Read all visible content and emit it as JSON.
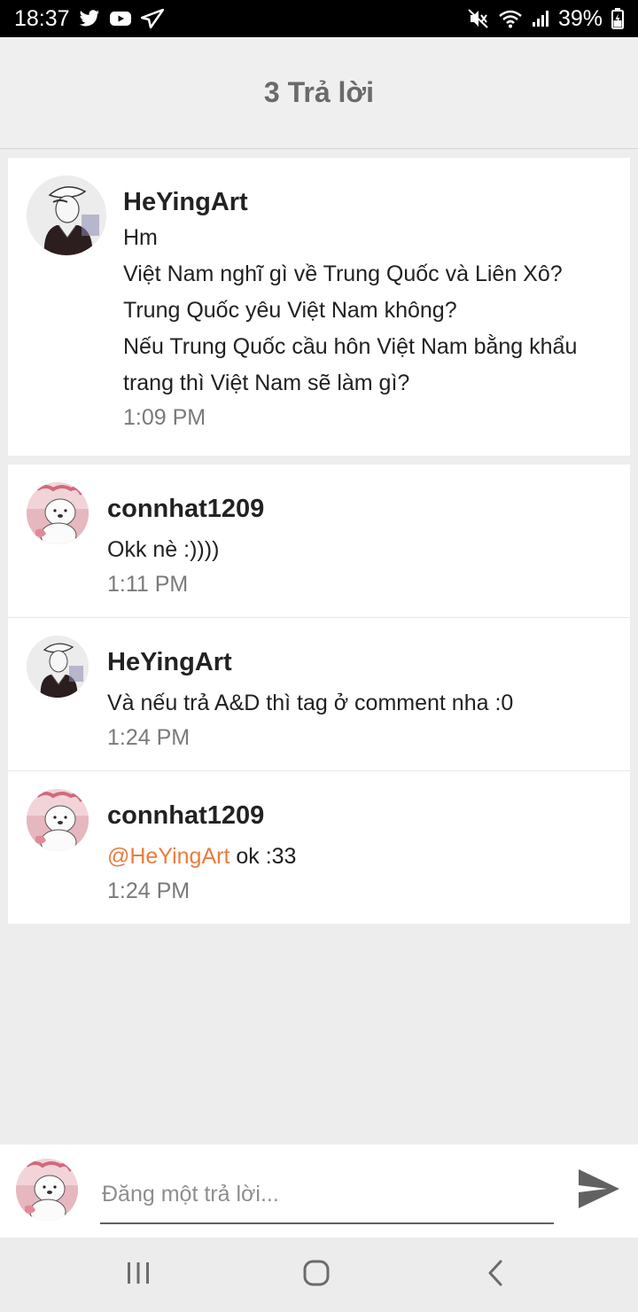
{
  "status_bar": {
    "time": "18:37",
    "battery": "39%",
    "icons": [
      "twitter-icon",
      "youtube-icon",
      "send-arrow-icon",
      "mute-icon",
      "wifi-icon",
      "signal-icon",
      "battery-icon"
    ]
  },
  "header": {
    "title": "3 Trả lời"
  },
  "post": {
    "author": "HeYingArt",
    "lines": [
      "Hm",
      "Việt Nam nghĩ gì về Trung Quốc và Liên Xô?",
      "Trung Quốc yêu Việt Nam không?",
      "Nếu Trung Quốc cầu hôn Việt Nam bằng khẩu",
      "trang thì Việt Nam sẽ làm gì?"
    ],
    "time": "1:09 PM"
  },
  "replies": [
    {
      "author": "connhat1209",
      "text": "Okk nè :))))",
      "time": "1:11 PM"
    },
    {
      "author": "HeYingArt",
      "text": "Và nếu trả A&D thì tag ở comment nha :0",
      "time": "1:24 PM"
    },
    {
      "author": "connhat1209",
      "mention": "@HeYingArt",
      "text": " ok :33",
      "time": "1:24 PM"
    }
  ],
  "composer": {
    "placeholder": "Đăng một trả lời..."
  },
  "colors": {
    "accent": "#ea7c3f",
    "header_bg": "#efefef",
    "page_bg": "#ededed"
  }
}
